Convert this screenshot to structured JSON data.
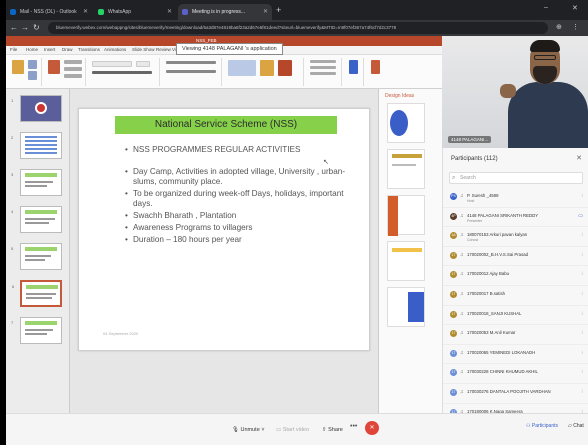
{
  "browser": {
    "tabs": [
      {
        "label": "Mail - NSS (DL) - Outlook",
        "favicon_color": "#0a66c2"
      },
      {
        "label": "WhatsApp",
        "favicon_color": "#25d366"
      },
      {
        "label": "Meeting is in progress...",
        "favicon_color": "#5b5fc7"
      }
    ],
    "url": "bluemeverify.webex.com/webappng/sites/bluemeverify/meeting/download/6a3d87e4819ba6f23a2d67e6f81deed?siteurl=bluemeverify&MTID=m9f07ef367a74f6cf7d2c3778"
  },
  "ppt": {
    "title_bar": "NSS_FEB",
    "menu_tabs": [
      "File",
      "Home",
      "Insert",
      "Draw",
      "Transitions",
      "Animations",
      "Slide Show",
      "Review",
      "View",
      "Help"
    ],
    "viewing_banner": "Viewing 4148 PALAGANI 's application",
    "design_ideas_title": "Design Ideas",
    "slide_count_labels": [
      "1",
      "2",
      "3",
      "4",
      "5",
      "6",
      "7"
    ]
  },
  "slide": {
    "title": "National Service Scheme (NSS)",
    "bullets": [
      "NSS PROGRAMMES REGULAR ACTIVITIES",
      "Day Camp, Activities in adopted village, University , urban-slums, community place.",
      "To be organized during week-off Days, holidays, important days.",
      "Swachh Bharath , Plantation",
      "Awareness Programs to villagers",
      "Duration – 180 hours per year"
    ],
    "date": "04 September 2020"
  },
  "video": {
    "name_tag": "4148 PALAGANI..."
  },
  "participants": {
    "header": "Participants (112)",
    "search_placeholder": "Search",
    "rows": [
      {
        "initials": "PS",
        "name": "P. Suresh _4588",
        "role": "Host",
        "color": "#3a62c8"
      },
      {
        "initials": "4P",
        "name": "4148 PALAGANI SRIKANTH REDDY",
        "role": "Presenter",
        "color": "#5a3e2b"
      },
      {
        "initials": "1A",
        "name": "180070153 Arkuri pavan kalyan",
        "role": "Cohost",
        "color": "#b08a2e"
      },
      {
        "initials": "17",
        "name": "170020002_B.H.V.S.Sai Prasad",
        "role": "",
        "color": "#b08a2e"
      },
      {
        "initials": "17",
        "name": "170020012 Ajay Babu",
        "role": "",
        "color": "#b08a2e"
      },
      {
        "initials": "17",
        "name": "170020017 B.satish",
        "role": "",
        "color": "#b08a2e"
      },
      {
        "initials": "17",
        "name": "170020018_SANJI KUSHAL",
        "role": "",
        "color": "#b08a2e"
      },
      {
        "initials": "17",
        "name": "170020053 M.Anil Kumar",
        "role": "",
        "color": "#b08a2e"
      },
      {
        "initials": "17",
        "name": "170020065 YEMINEDI LOKANADH",
        "role": "",
        "color": "#6b8fd6"
      },
      {
        "initials": "17",
        "name": "170030228 CHINNI KHUMUD AKHIL",
        "role": "",
        "color": "#6b8fd6"
      },
      {
        "initials": "17",
        "name": "170030276 DANTALA POOJITH VARDHAN",
        "role": "",
        "color": "#6b8fd6"
      },
      {
        "initials": "17",
        "name": "170180006 K.Naga Sameera",
        "role": "",
        "color": "#6b8fd6"
      }
    ]
  },
  "callbar": {
    "unmute": "Unmute",
    "start_video": "Start video",
    "share": "Share",
    "more": "•••",
    "leave": "✕",
    "participants": "Participants",
    "chat": "Chat"
  }
}
